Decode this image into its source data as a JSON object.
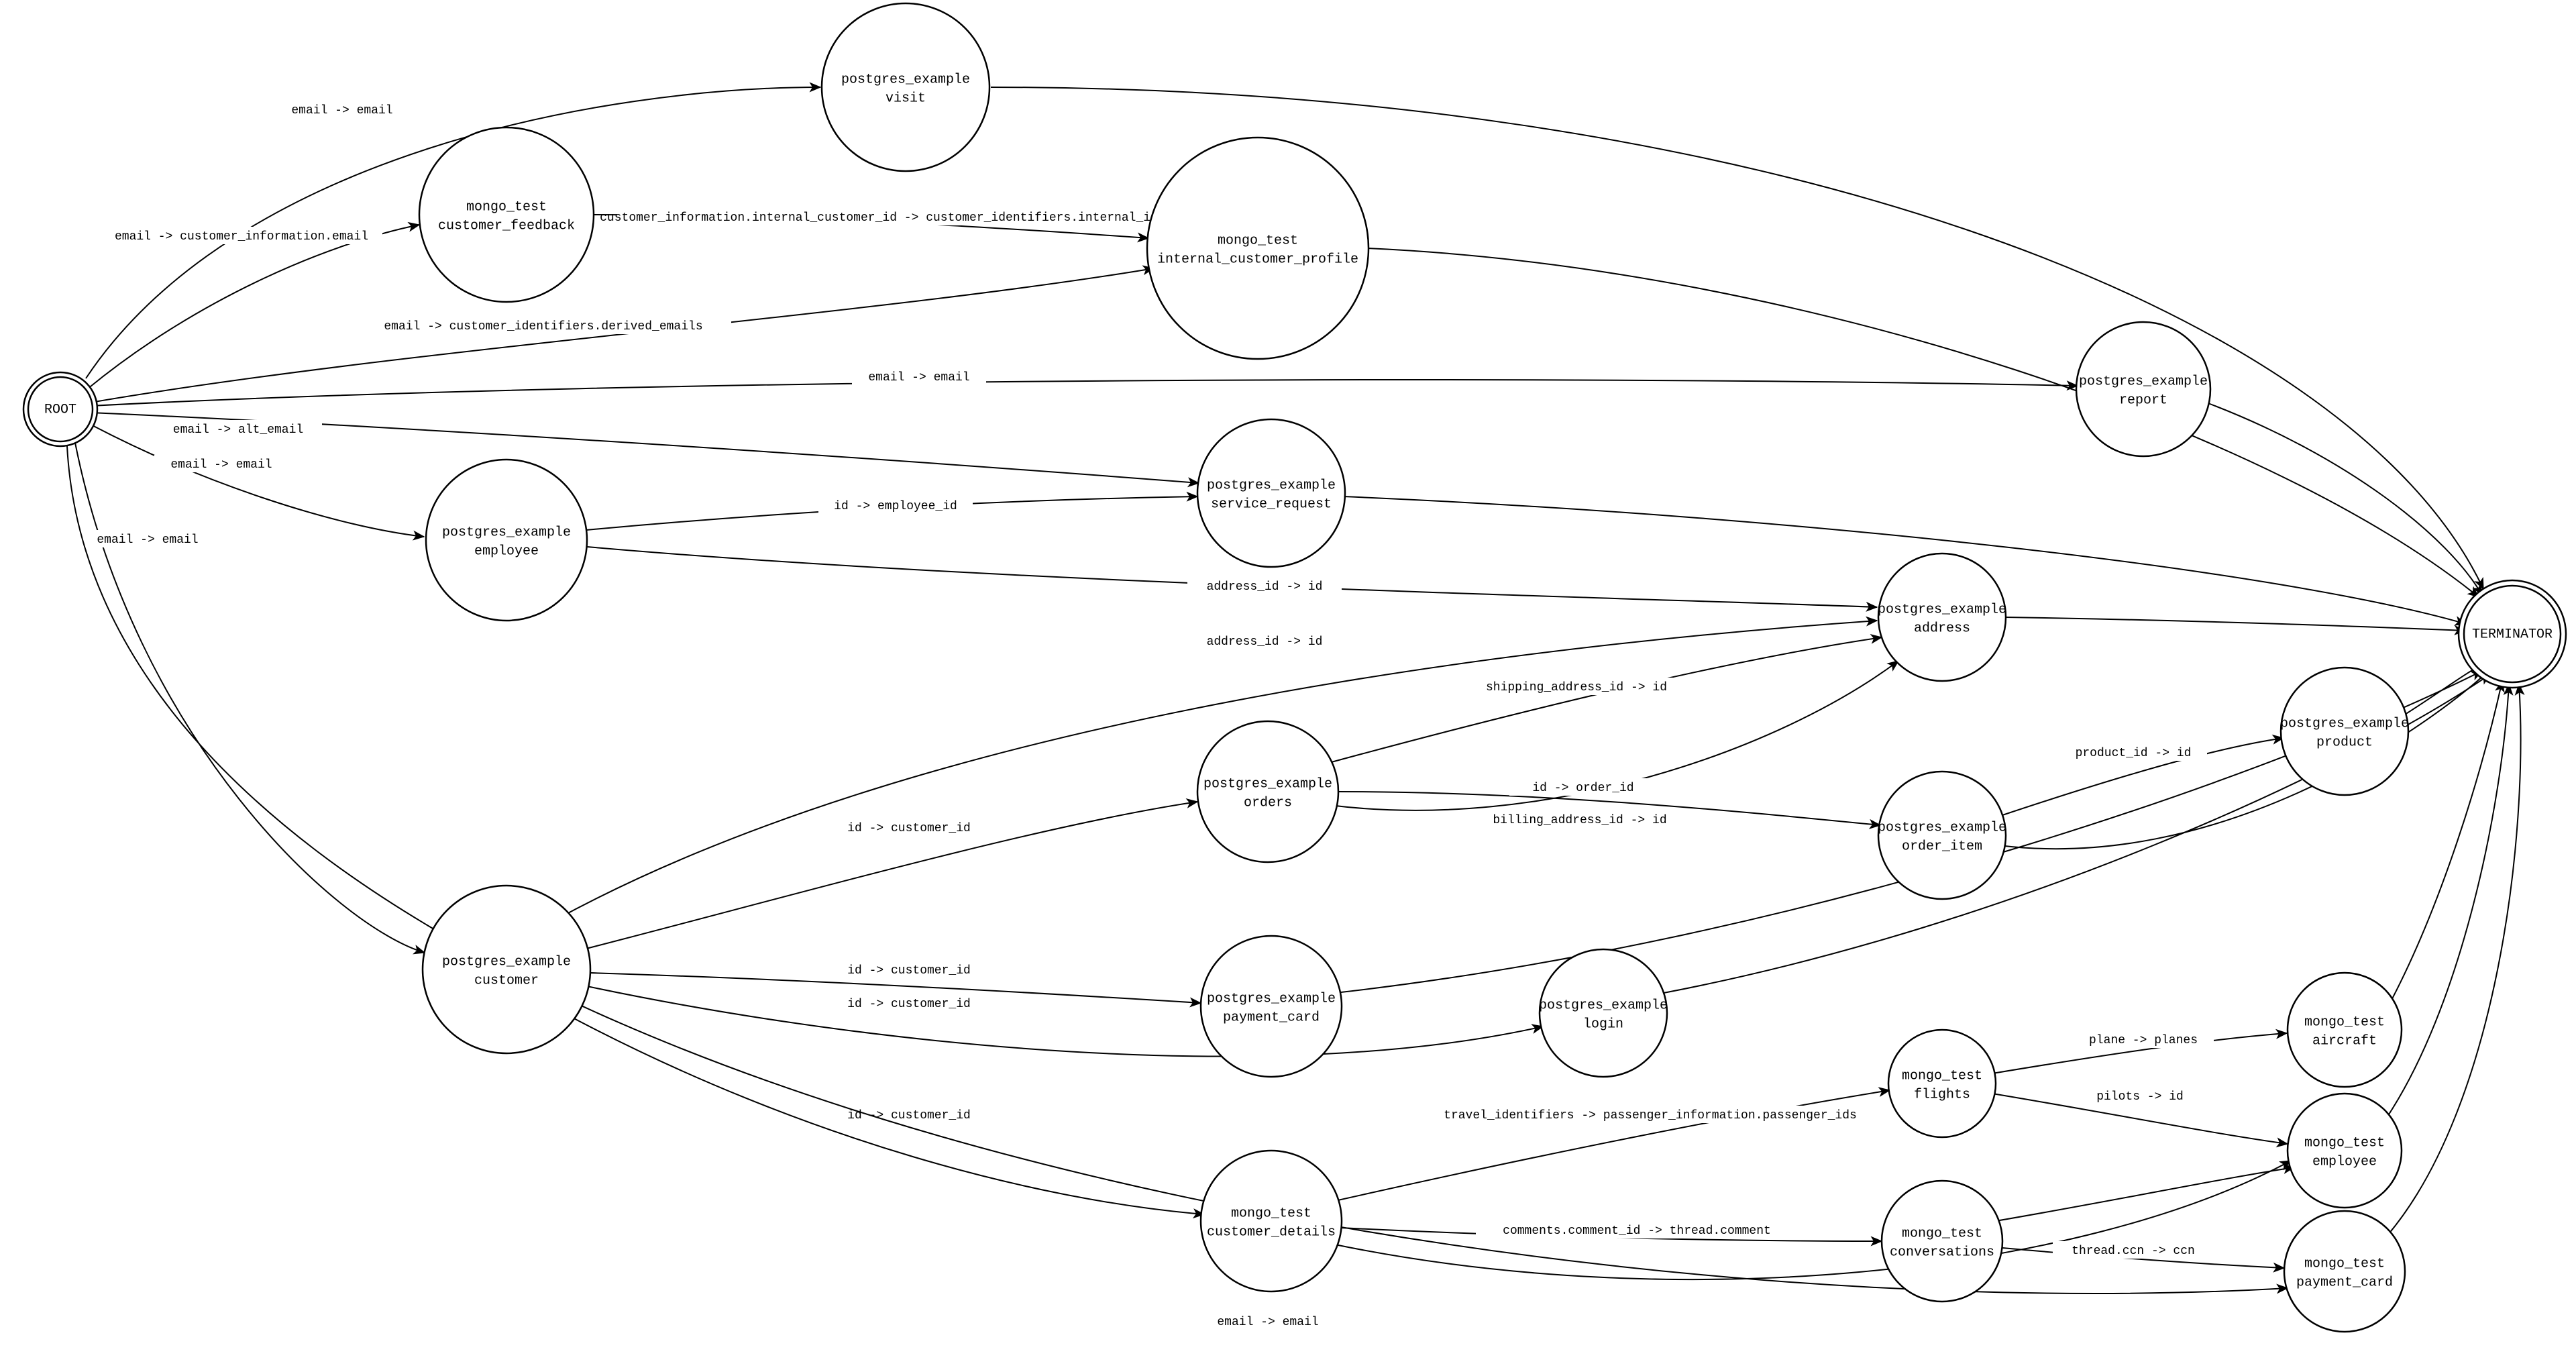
{
  "nodes": {
    "root": {
      "line1": "ROOT"
    },
    "terminator": {
      "line1": "TERMINATOR"
    },
    "visit": {
      "line1": "postgres_example",
      "line2": "visit"
    },
    "cust_feedback": {
      "line1": "mongo_test",
      "line2": "customer_feedback"
    },
    "int_profile": {
      "line1": "mongo_test",
      "line2": "internal_customer_profile"
    },
    "report": {
      "line1": "postgres_example",
      "line2": "report"
    },
    "employee_pg": {
      "line1": "postgres_example",
      "line2": "employee"
    },
    "service_req": {
      "line1": "postgres_example",
      "line2": "service_request"
    },
    "address": {
      "line1": "postgres_example",
      "line2": "address"
    },
    "customer": {
      "line1": "postgres_example",
      "line2": "customer"
    },
    "orders": {
      "line1": "postgres_example",
      "line2": "orders"
    },
    "order_item": {
      "line1": "postgres_example",
      "line2": "order_item"
    },
    "product": {
      "line1": "postgres_example",
      "line2": "product"
    },
    "payment_card_pg": {
      "line1": "postgres_example",
      "line2": "payment_card"
    },
    "login": {
      "line1": "postgres_example",
      "line2": "login"
    },
    "cust_details": {
      "line1": "mongo_test",
      "line2": "customer_details"
    },
    "flights": {
      "line1": "mongo_test",
      "line2": "flights"
    },
    "conversations": {
      "line1": "mongo_test",
      "line2": "conversations"
    },
    "aircraft": {
      "line1": "mongo_test",
      "line2": "aircraft"
    },
    "employee_mg": {
      "line1": "mongo_test",
      "line2": "employee"
    },
    "payment_card_mg": {
      "line1": "mongo_test",
      "line2": "payment_card"
    }
  },
  "edges": {
    "e_root_visit": "email -> email",
    "e_root_feedback": "email -> customer_information.email",
    "e_feedback_profile": "customer_information.internal_customer_id -> customer_identifiers.internal_id",
    "e_root_profile": "email -> customer_identifiers.derived_emails",
    "e_root_report": "email -> email",
    "e_root_servicereq": "email -> alt_email",
    "e_root_employee": "email -> email",
    "e_root_customer": "email -> email",
    "e_employee_service": "id -> employee_id",
    "e_employee_address": "address_id -> id",
    "e_customer_address": "address_id -> id",
    "e_orders_ship_addr": "shipping_address_id -> id",
    "e_orders_bill_addr": "billing_address_id -> id",
    "e_customer_orders": "id -> customer_id",
    "e_orders_orderitem": "id -> order_id",
    "e_orderitem_product": "product_id -> id",
    "e_customer_payment": "id -> customer_id",
    "e_customer_login": "id -> customer_id",
    "e_customer_details": "id -> customer_id",
    "e_details_flights": "travel_identifiers -> passenger_information.passenger_ids",
    "e_details_convo": "comments.comment_id -> thread.comment",
    "e_flights_aircraft": "plane -> planes",
    "e_flights_employee": "pilots -> id",
    "e_convo_paycard": "thread.ccn -> ccn",
    "e_root_paycard_mg": "email -> email"
  }
}
